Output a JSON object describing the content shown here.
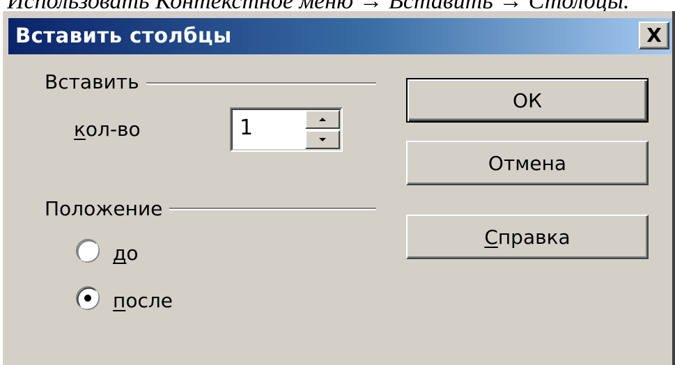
{
  "document_caption": "Использовать Контекстное меню → Вставить → Столбцы.",
  "dialog": {
    "title": "Вставить столбцы",
    "close_label": "X",
    "insert_group": {
      "label": "Вставить",
      "count_label_underlined": "к",
      "count_label_rest": "ол-во",
      "count_value": "1"
    },
    "position_group": {
      "label": "Положение",
      "options": [
        {
          "underlined": "д",
          "rest": "о",
          "selected": false
        },
        {
          "underlined": "п",
          "rest": "осле",
          "selected": true
        }
      ]
    },
    "buttons": {
      "ok": "ОК",
      "cancel": "Отмена",
      "help_underlined": "С",
      "help_rest": "правка"
    }
  },
  "colors": {
    "dialog_bg": "#d4d0c8",
    "title_gradient_start": "#0a246a",
    "title_gradient_end": "#a6caf0",
    "title_text": "#ffffff"
  }
}
